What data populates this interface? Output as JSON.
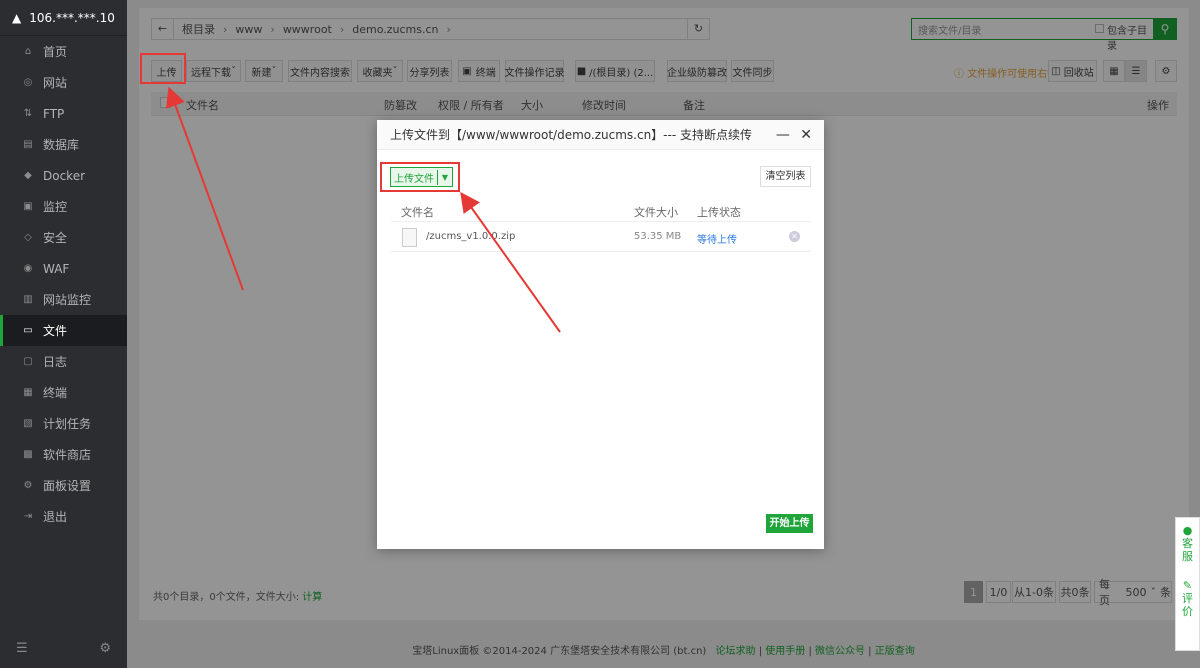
{
  "sidebar": {
    "server_ip": "106.***.***.10",
    "badge": "0",
    "items": [
      {
        "label": "首页",
        "icon": "home-icon"
      },
      {
        "label": "网站",
        "icon": "globe-icon"
      },
      {
        "label": "FTP",
        "icon": "ftp-icon"
      },
      {
        "label": "数据库",
        "icon": "database-icon"
      },
      {
        "label": "Docker",
        "icon": "docker-icon"
      },
      {
        "label": "监控",
        "icon": "monitor-icon"
      },
      {
        "label": "安全",
        "icon": "shield-icon"
      },
      {
        "label": "WAF",
        "icon": "waf-icon"
      },
      {
        "label": "网站监控",
        "icon": "chart-icon"
      },
      {
        "label": "文件",
        "icon": "folder-icon"
      },
      {
        "label": "日志",
        "icon": "log-icon"
      },
      {
        "label": "终端",
        "icon": "terminal-icon"
      },
      {
        "label": "计划任务",
        "icon": "task-icon"
      },
      {
        "label": "软件商店",
        "icon": "store-icon"
      },
      {
        "label": "面板设置",
        "icon": "settings-icon"
      },
      {
        "label": "退出",
        "icon": "logout-icon"
      }
    ],
    "active_index": 9
  },
  "address_bar": {
    "crumbs": [
      "根目录",
      "www",
      "wwwroot",
      "demo.zucms.cn"
    ]
  },
  "search": {
    "placeholder": "搜索文件/目录",
    "subdir_label": "包含子目录"
  },
  "toolbar": {
    "upload": "上传",
    "remote_download": "远程下载",
    "new": "新建",
    "content_search": "文件内容搜索",
    "favorites": "收藏夹",
    "share_list": "分享列表",
    "terminal": "终端",
    "op_log": "文件操作记录",
    "disk": "/(根目录) (2...",
    "tamper": "企业级防篡改",
    "sync": "文件同步",
    "right_click_tip": "文件操作可使用右键",
    "recycle": "回收站"
  },
  "table_header": {
    "name": "文件名",
    "tamper": "防篡改",
    "perm": "权限 / 所有者",
    "size": "大小",
    "mtime": "修改时间",
    "remark": "备注",
    "action": "操作"
  },
  "list_footer": {
    "summary": "共0个目录，0个文件，文件大小:",
    "calc": "计算",
    "page": "1",
    "page_total": "1/0",
    "range": "从1-0条",
    "total": "共0条",
    "per_page_label": "每页",
    "per_page": "500",
    "per_page_unit": "条"
  },
  "footer": {
    "copyright": "宝塔Linux面板 ©2014-2024 广东堡塔安全技术有限公司 (bt.cn)",
    "links": [
      "论坛求助",
      "使用手册",
      "微信公众号",
      "正版查询"
    ]
  },
  "float_panel": {
    "service": "客服",
    "review": "评价"
  },
  "modal": {
    "title": "上传文件到【/www/wwwroot/demo.zucms.cn】--- 支持断点续传",
    "upload_file_btn": "上传文件",
    "clear_btn": "清空列表",
    "col_name": "文件名",
    "col_size": "文件大小",
    "col_status": "上传状态",
    "files": [
      {
        "name": "/zucms_v1.0.0.zip",
        "size": "53.35 MB",
        "status": "等待上传"
      }
    ],
    "start_btn": "开始上传"
  },
  "colors": {
    "accent": "#20a53a",
    "sidebar_bg": "#2b2d31",
    "annotation": "#e53935",
    "badge": "#e65c1f"
  }
}
